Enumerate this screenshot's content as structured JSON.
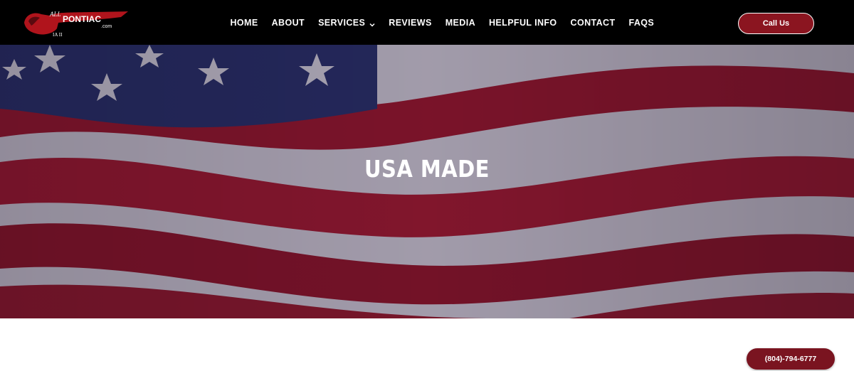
{
  "header": {
    "logo": {
      "text_top": "ALL",
      "text_main": "PONTIAC",
      "text_sub": ".com",
      "text_badge": "IA II"
    },
    "nav": [
      {
        "label": "HOME"
      },
      {
        "label": "ABOUT"
      },
      {
        "label": "SERVICES",
        "icon": "chevron-down-icon"
      },
      {
        "label": "REVIEWS"
      },
      {
        "label": "MEDIA"
      },
      {
        "label": "HELPFUL INFO"
      },
      {
        "label": "CONTACT"
      },
      {
        "label": "FAQS"
      }
    ],
    "call_button": "Call Us"
  },
  "hero": {
    "title": "USA MADE",
    "background": "american-flag-image"
  },
  "floating_call": {
    "label": "(804)-794-6777"
  },
  "colors": {
    "brand_red": "#8b1520",
    "header_bg": "#000000"
  }
}
